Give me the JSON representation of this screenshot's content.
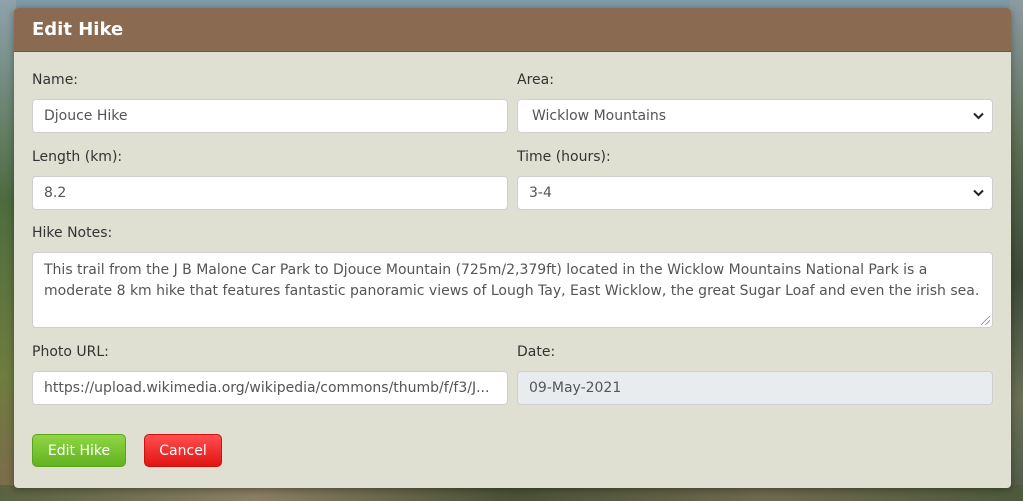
{
  "modal": {
    "title": "Edit Hike"
  },
  "form": {
    "name": {
      "label": "Name:",
      "value": "Djouce Hike"
    },
    "area": {
      "label": "Area:",
      "value": "Wicklow Mountains"
    },
    "length": {
      "label": "Length (km):",
      "value": "8.2"
    },
    "time": {
      "label": "Time (hours):",
      "value": "3-4"
    },
    "notes": {
      "label": "Hike Notes:",
      "value": "This trail from the J B Malone Car Park to Djouce Mountain (725m/2,379ft) located in the Wicklow Mountains National Park is a moderate 8 km  hike that features fantastic panoramic views of Lough Tay, East Wicklow, the great Sugar Loaf and even the irish sea."
    },
    "photo_url": {
      "label": "Photo URL:",
      "value": "https://upload.wikimedia.org/wikipedia/commons/thumb/f/f3/J..."
    },
    "date": {
      "label": "Date:",
      "value": "09-May-2021"
    }
  },
  "buttons": {
    "edit_label": "Edit Hike",
    "cancel_label": "Cancel"
  },
  "icons": {
    "select_arrow": "chevron-down-icon"
  },
  "colors": {
    "header": "#8a6a50",
    "panel": "#dfdfd2",
    "edit_button": "#6fbe26",
    "cancel_button": "#f01c1c"
  }
}
